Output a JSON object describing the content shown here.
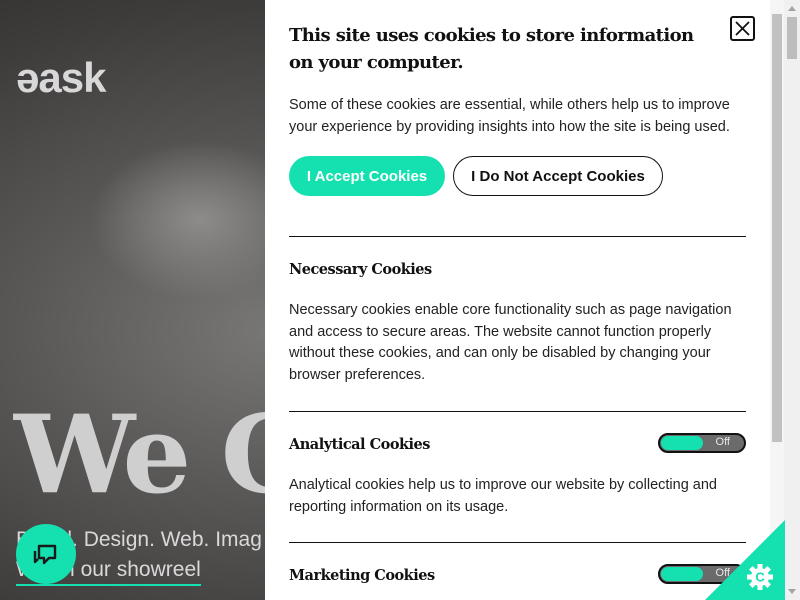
{
  "background": {
    "logo_text": "ǝask",
    "hero_title": "We C",
    "hero_subtitle": "Brand. Design. Web. Imag",
    "hero_link": "Watch our showreel"
  },
  "cookie_panel": {
    "title": "This site uses cookies to store information on your computer.",
    "intro": "Some of these cookies are essential, while others help us to improve your experience by providing insights into how the site is being used.",
    "accept_label": "I Accept Cookies",
    "decline_label": "I Do Not Accept Cookies",
    "sections": [
      {
        "title": "Necessary Cookies",
        "text": "Necessary cookies enable core functionality such as page navigation and access to secure areas. The website cannot function properly without these cookies, and can only be disabled by changing your browser preferences."
      },
      {
        "title": "Analytical Cookies",
        "text": "Analytical cookies help us to improve our website by collecting and reporting information on its usage.",
        "toggle_label": "Off"
      },
      {
        "title": "Marketing Cookies",
        "toggle_label": "Off"
      }
    ]
  },
  "colors": {
    "accent": "#15e0b0",
    "text": "#111111",
    "toggle_off": "#6b6b6b"
  },
  "icons": {
    "close": "close-icon",
    "chat": "chat-icon",
    "cookie_control": "cookie-gear-icon"
  }
}
